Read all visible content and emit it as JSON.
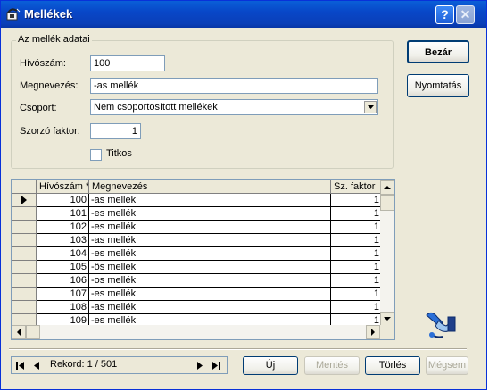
{
  "window": {
    "title": "Mellékek",
    "help_icon": "help-icon",
    "close_icon": "close-icon",
    "app_icon": "phone-icon"
  },
  "form": {
    "group_title": "Az mellék adatai",
    "hivoszam_label": "Hívószám:",
    "hivoszam_value": "100",
    "megnevezes_label": "Megnevezés:",
    "megnevezes_value": "-as mellék",
    "csoport_label": "Csoport:",
    "csoport_value": "Nem csoportosított mellékek",
    "szorzo_label": "Szorzó faktor:",
    "szorzo_value": "1",
    "titkos_label": "Titkos",
    "titkos_checked": false
  },
  "buttons": {
    "bezar": "Bezár",
    "nyomtatas": "Nyomtatás",
    "uj": "Új",
    "mentes": "Mentés",
    "torles": "Törlés",
    "megsem": "Mégsem"
  },
  "grid": {
    "columns": [
      "Hívószám *",
      "Megnevezés",
      "Sz. faktor"
    ],
    "rows": [
      {
        "hivoszam": "100",
        "megnevezes": "-as mellék",
        "faktor": "1",
        "current": true
      },
      {
        "hivoszam": "101",
        "megnevezes": "-es mellék",
        "faktor": "1"
      },
      {
        "hivoszam": "102",
        "megnevezes": "-es mellék",
        "faktor": "1"
      },
      {
        "hivoszam": "103",
        "megnevezes": "-as mellék",
        "faktor": "1"
      },
      {
        "hivoszam": "104",
        "megnevezes": "-es mellék",
        "faktor": "1"
      },
      {
        "hivoszam": "105",
        "megnevezes": "-ös mellék",
        "faktor": "1"
      },
      {
        "hivoszam": "106",
        "megnevezes": "-os mellék",
        "faktor": "1"
      },
      {
        "hivoszam": "107",
        "megnevezes": "-es mellék",
        "faktor": "1"
      },
      {
        "hivoszam": "108",
        "megnevezes": "-as mellék",
        "faktor": "1"
      },
      {
        "hivoszam": "109",
        "megnevezes": "-es mellék",
        "faktor": "1"
      }
    ]
  },
  "navigator": {
    "record_label": "Rekord: 1 / 501"
  },
  "colors": {
    "titlebar": "#0a5fd8",
    "window_bg": "#ece9d8",
    "border": "#7f9db9"
  }
}
